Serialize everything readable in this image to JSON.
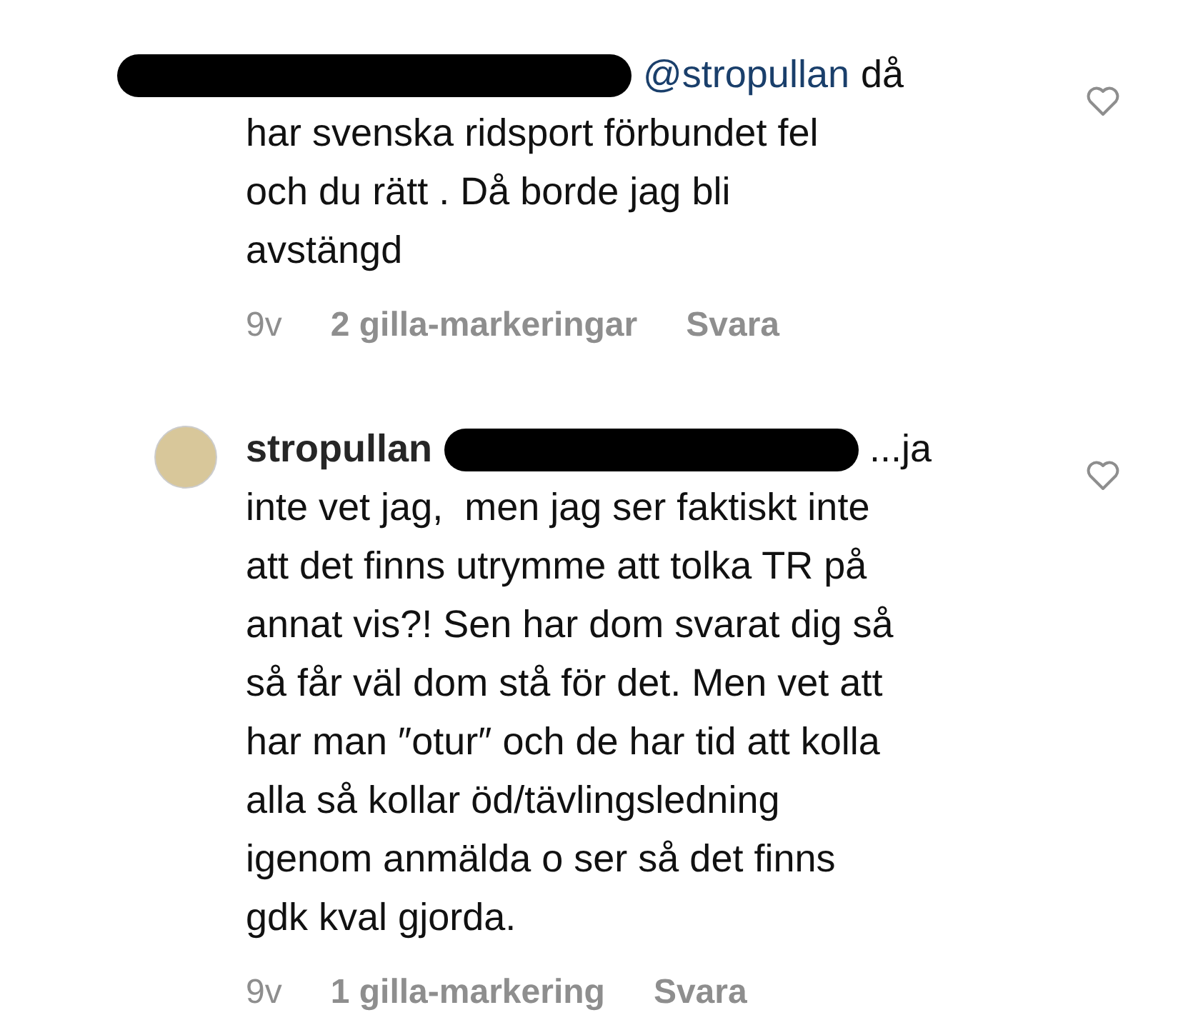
{
  "comments": [
    {
      "avatar": false,
      "redacted": true,
      "mention": "@stropullan",
      "lead": "då",
      "lines": [
        "har svenska ridsport förbundet fel",
        "och du rätt . Då borde jag bli",
        "avstängd"
      ],
      "time": "9v",
      "likes": "2 gilla-markeringar",
      "reply": "Svara",
      "liked": false
    },
    {
      "avatar": true,
      "author": "stropullan",
      "redacted": true,
      "lead": "...ja",
      "lines": [
        "inte vet jag,  men jag ser faktiskt inte",
        "att det finns utrymme att tolka TR på",
        "annat vis?! Sen har dom svarat dig så",
        "så får väl dom stå för det. Men vet att",
        "har man ″otur″ och de har tid att kolla",
        "alla så kollar öd/tävlingsledning",
        "igenom anmälda o ser så det finns",
        "gdk kval gjorda."
      ],
      "time": "9v",
      "likes": "1 gilla-markering",
      "reply": "Svara",
      "liked": false
    }
  ]
}
